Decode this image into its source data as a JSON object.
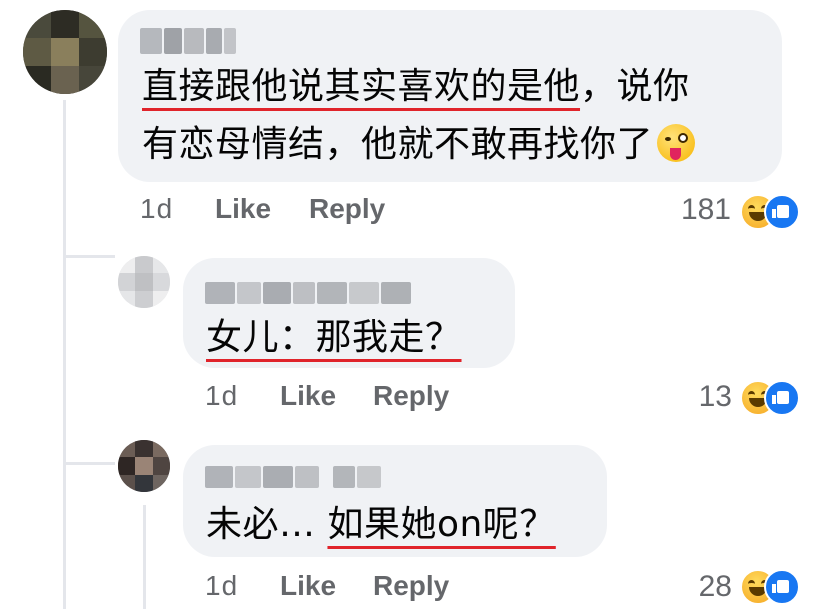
{
  "comments": [
    {
      "text_part1": "直接跟他说其实喜欢的是他",
      "text_part2": "，说你",
      "text_line2": "有恋母情结，他就不敢再找你了",
      "emoji": "winking-face-with-tongue",
      "time": "1d",
      "like_label": "Like",
      "reply_label": "Reply",
      "reaction_count": "181"
    },
    {
      "text_underlined": "女儿：那我走？",
      "time": "1d",
      "like_label": "Like",
      "reply_label": "Reply",
      "reaction_count": "13"
    },
    {
      "text_prefix": "未必… ",
      "text_underlined": "如果她on呢？",
      "time": "1d",
      "like_label": "Like",
      "reply_label": "Reply",
      "reaction_count": "28"
    }
  ],
  "reactions": [
    "haha-icon",
    "like-icon"
  ],
  "colors": {
    "bubble": "#f0f2f5",
    "meta_text": "#65676b",
    "underline": "#e0242b",
    "like_blue": "#1877f2"
  }
}
